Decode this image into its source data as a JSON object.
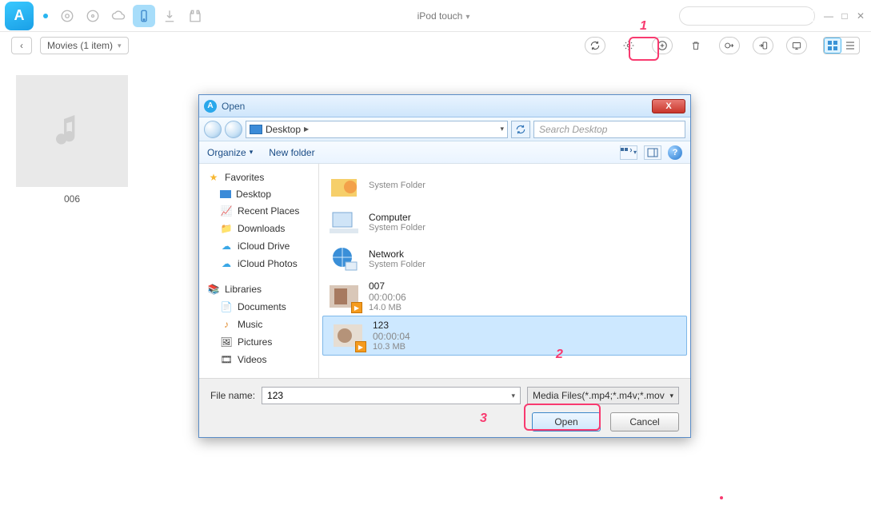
{
  "titlebar": {
    "device": "iPod touch"
  },
  "toolbar": {
    "breadcrumb": "Movies (1 item)"
  },
  "thumb": {
    "caption": "006"
  },
  "callouts": {
    "one": "1",
    "two": "2",
    "three": "3"
  },
  "dialog": {
    "title": "Open",
    "address": "Desktop",
    "search_placeholder": "Search Desktop",
    "organize": "Organize",
    "new_folder": "New folder",
    "sidebar": {
      "favorites": "Favorites",
      "desktop": "Desktop",
      "recent": "Recent Places",
      "downloads": "Downloads",
      "icloud_drive": "iCloud Drive",
      "icloud_photos": "iCloud Photos",
      "libraries": "Libraries",
      "documents": "Documents",
      "music": "Music",
      "pictures": "Pictures",
      "videos": "Videos"
    },
    "files": {
      "sys1": {
        "name": "",
        "sub": "System Folder"
      },
      "computer": {
        "name": "Computer",
        "sub": "System Folder"
      },
      "network": {
        "name": "Network",
        "sub": "System Folder"
      },
      "f007": {
        "name": "007",
        "dur": "00:00:06",
        "size": "14.0 MB"
      },
      "f123": {
        "name": "123",
        "dur": "00:00:04",
        "size": "10.3 MB"
      }
    },
    "filename_label": "File name:",
    "filename_value": "123",
    "filter": "Media Files(*.mp4;*.m4v;*.mov",
    "open": "Open",
    "cancel": "Cancel",
    "help": "?"
  }
}
